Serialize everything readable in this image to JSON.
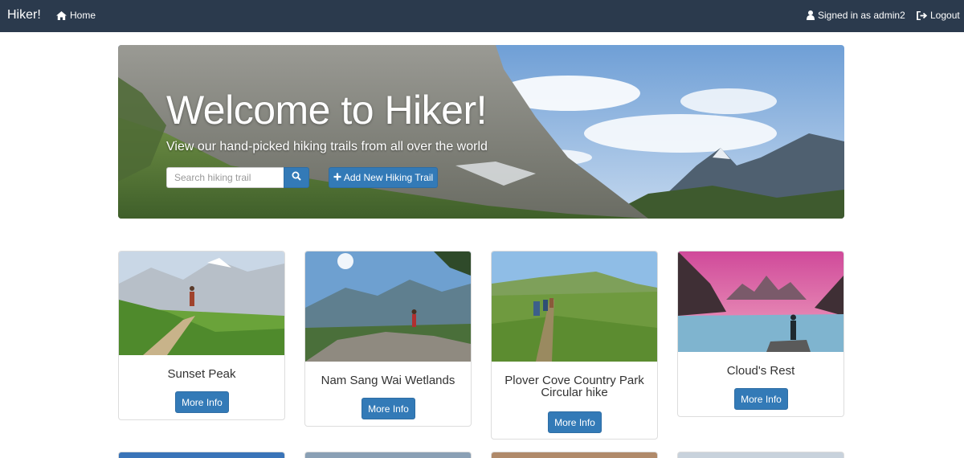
{
  "navbar": {
    "brand": "Hiker!",
    "home_label": "Home",
    "signed_in_label": "Signed in as admin2",
    "logout_label": "Logout"
  },
  "hero": {
    "title": "Welcome to Hiker!",
    "subtitle": "View our hand-picked hiking trails from all over the world",
    "search_placeholder": "Search hiking trail",
    "add_button_label": "Add New Hiking Trail"
  },
  "trails": [
    {
      "title": "Sunset Peak",
      "button_label": "More Info"
    },
    {
      "title": "Nam Sang Wai Wetlands",
      "button_label": "More Info"
    },
    {
      "title": "Plover Cove Country Park Circular hike",
      "button_label": "More Info"
    },
    {
      "title": "Cloud's Rest",
      "button_label": "More Info"
    }
  ],
  "colors": {
    "navbar_bg": "#2b3a4d",
    "primary_button": "#337ab7",
    "card_border": "#dddddd"
  },
  "icons": {
    "home": "home-icon",
    "user": "user-icon",
    "logout": "logout-icon",
    "search": "search-icon",
    "plus": "plus-icon"
  }
}
